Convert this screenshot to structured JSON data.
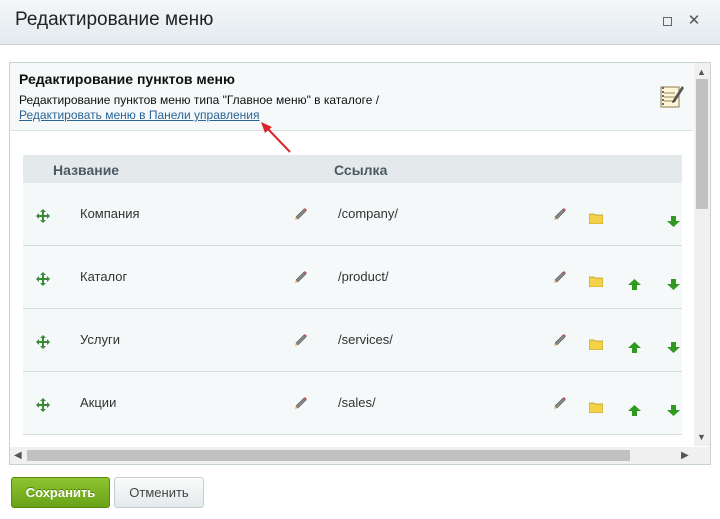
{
  "window": {
    "title": "Редактирование меню"
  },
  "header": {
    "title": "Редактирование пунктов меню",
    "description": "Редактирование пунктов меню типа \"Главное меню\" в каталоге /",
    "panel_link": "Редактировать меню в Панели управления"
  },
  "table": {
    "col_name": "Название",
    "col_link": "Ссылка",
    "rows": [
      {
        "name": "Компания",
        "link": "/company/",
        "has_up": false,
        "has_down": true
      },
      {
        "name": "Каталог",
        "link": "/product/",
        "has_up": true,
        "has_down": true
      },
      {
        "name": "Услуги",
        "link": "/services/",
        "has_up": true,
        "has_down": true
      },
      {
        "name": "Акции",
        "link": "/sales/",
        "has_up": true,
        "has_down": true
      }
    ]
  },
  "buttons": {
    "save": "Сохранить",
    "cancel": "Отменить"
  },
  "colors": {
    "accent_green": "#6aa218",
    "link_blue": "#2a6496",
    "annotation_red": "#d9262a"
  }
}
